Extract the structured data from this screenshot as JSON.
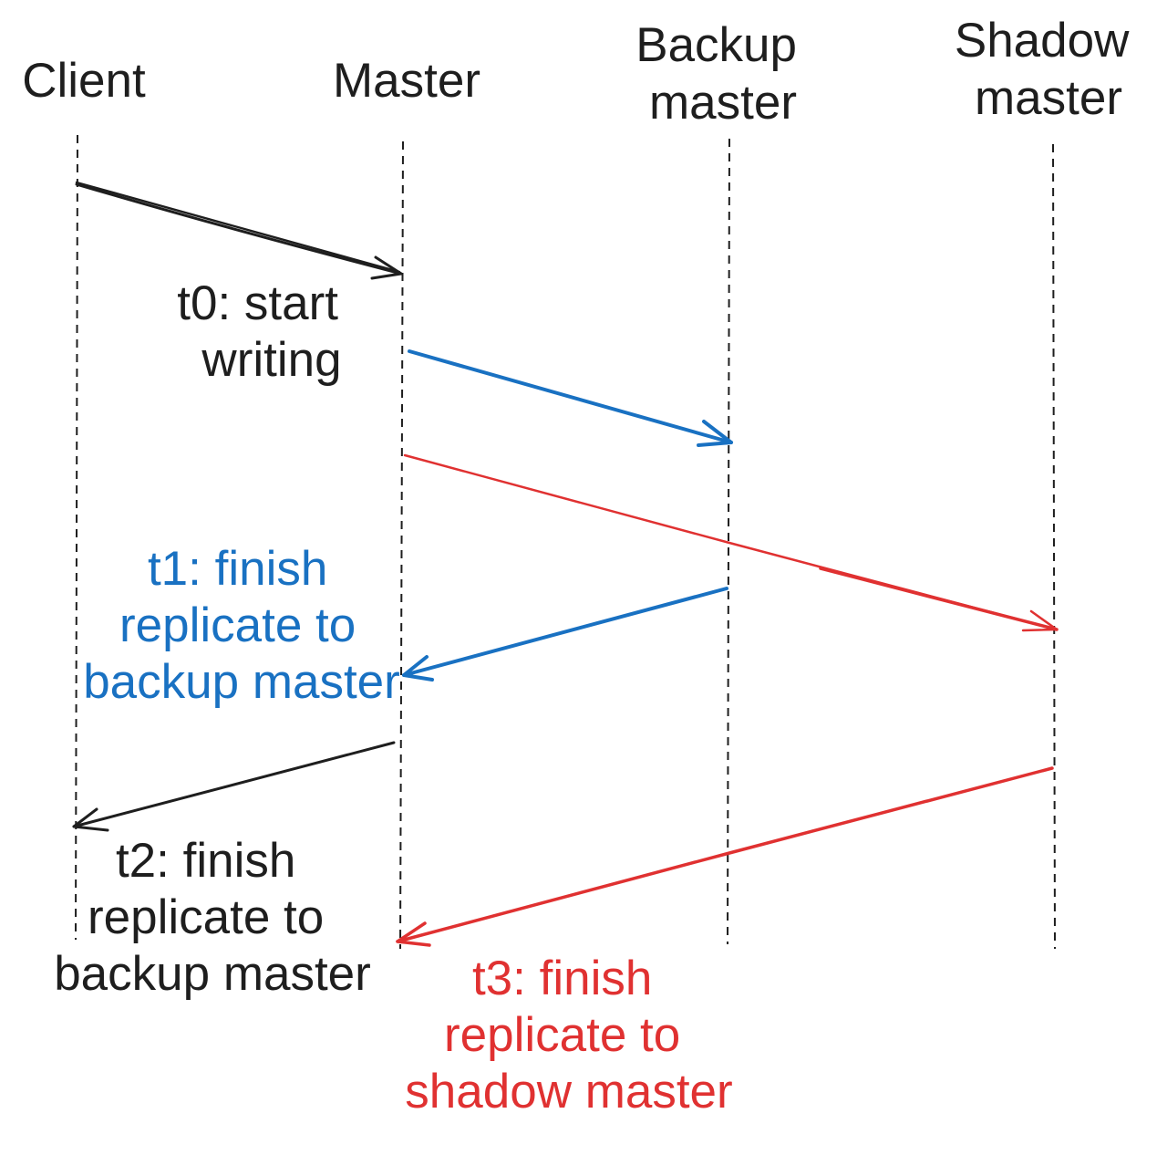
{
  "colors": {
    "black": "#1e1e1e",
    "blue": "#1971c2",
    "red": "#e03131"
  },
  "participants": {
    "client": {
      "lines": [
        "Client"
      ]
    },
    "master": {
      "lines": [
        "Master"
      ]
    },
    "backup": {
      "lines": [
        "Backup",
        "master"
      ]
    },
    "shadow": {
      "lines": [
        "Shadow",
        "master"
      ]
    }
  },
  "messages": {
    "client_to_master": {
      "from": "Client",
      "to": "Master",
      "color": "black"
    },
    "master_to_backup": {
      "from": "Master",
      "to": "Backup master",
      "color": "blue"
    },
    "master_to_shadow": {
      "from": "Master",
      "to": "Shadow master",
      "color": "red"
    },
    "backup_to_master": {
      "from": "Backup master",
      "to": "Master",
      "color": "blue"
    },
    "master_to_client": {
      "from": "Master",
      "to": "Client",
      "color": "black"
    },
    "shadow_to_master": {
      "from": "Shadow master",
      "to": "Master",
      "color": "red"
    }
  },
  "annotations": {
    "t0": {
      "lines": [
        "t0: start",
        "writing"
      ],
      "color": "black"
    },
    "t1": {
      "lines": [
        "t1: finish",
        "replicate to",
        "backup master"
      ],
      "color": "blue"
    },
    "t2": {
      "lines": [
        "t2: finish",
        "replicate to",
        "backup master"
      ],
      "color": "black"
    },
    "t3": {
      "lines": [
        "t3: finish",
        "replicate to",
        "shadow master"
      ],
      "color": "red"
    }
  }
}
